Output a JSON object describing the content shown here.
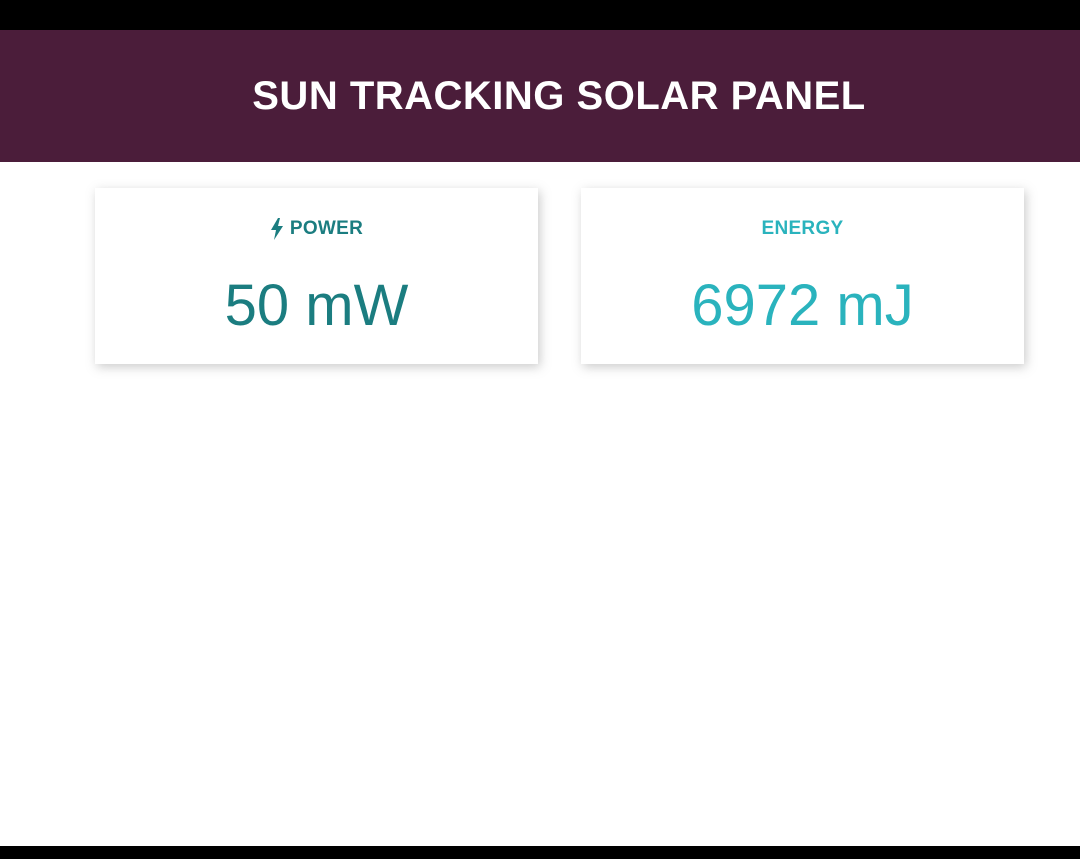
{
  "header": {
    "title": "SUN TRACKING SOLAR PANEL"
  },
  "cards": [
    {
      "label": "POWER",
      "icon": "bolt-icon",
      "value": "50 mW",
      "color": "#1b7d80"
    },
    {
      "label": "ENERGY",
      "value": "6972 mJ",
      "color": "#2ab3bd"
    }
  ],
  "colors": {
    "header_bg": "#4b1d3a",
    "header_text": "#ffffff"
  }
}
